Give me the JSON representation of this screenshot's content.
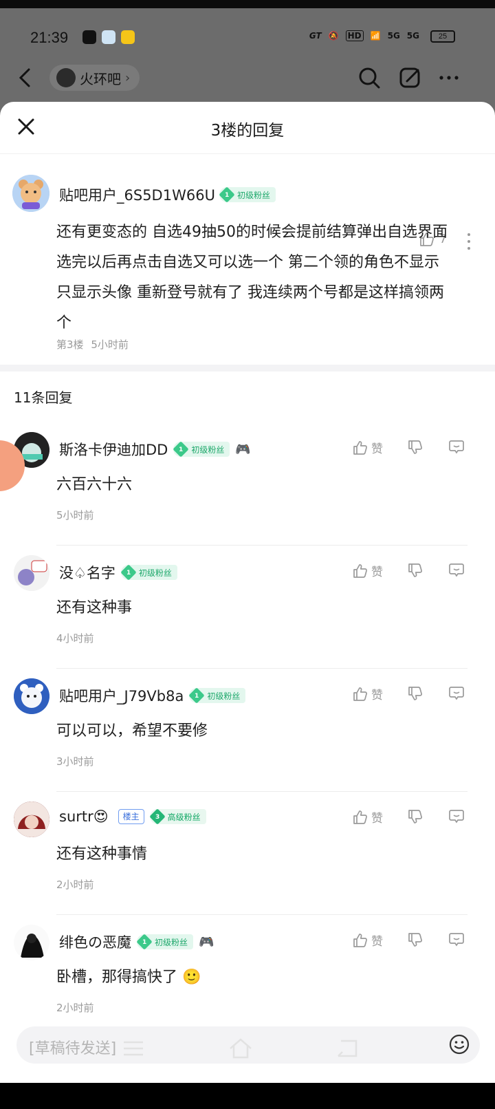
{
  "status": {
    "time": "21:39",
    "battery": "25",
    "signal1": "5G",
    "signal2": "5G",
    "hd": "HD",
    "gt": "GT"
  },
  "bg_nav": {
    "forum_name": "火环吧"
  },
  "sheet": {
    "title": "3楼的回复"
  },
  "main_post": {
    "username": "贴吧用户_6S5D1W66U",
    "badge_level": "1",
    "badge_label": "初级粉丝",
    "like_count": "7",
    "content_lines": [
      "还有更变态的 自选49抽50的时候会提前结算弹出自选界面",
      "选完以后再点击自选又可以选一个 第二个领的角色不显示",
      "只显示头像 重新登号就有了 我连续两个号都是这样搞领两",
      "个"
    ],
    "floor": "第3楼",
    "time": "5小时前"
  },
  "reply_count": "11条回复",
  "replies": [
    {
      "username": "斯洛卡伊迪加DD",
      "badge_level": "1",
      "badge_label": "初级粉丝",
      "text": "六百六十六",
      "time": "5小时前",
      "like_label": "赞"
    },
    {
      "username": "没♤名字",
      "badge_level": "1",
      "badge_label": "初级粉丝",
      "text": "还有这种事",
      "time": "4小时前",
      "like_label": "赞"
    },
    {
      "username": "贴吧用户_J79Vb8a",
      "badge_level": "1",
      "badge_label": "初级粉丝",
      "text": "可以可以，希望不要修",
      "time": "3小时前",
      "like_label": "赞"
    },
    {
      "username": "surtr😍",
      "owner_label": "楼主",
      "badge_level": "3",
      "badge_label": "高级粉丝",
      "text": "还有这种事情",
      "time": "2小时前",
      "like_label": "赞"
    },
    {
      "username": "绯色の恶魔",
      "badge_level": "1",
      "badge_label": "初级粉丝",
      "text": "卧槽，那得搞快了 🙂",
      "time": "2小时前",
      "like_label": "赞"
    }
  ],
  "composer": {
    "placeholder": "[草稿待发送]"
  },
  "colors": {
    "badge_green": "#3cc98a",
    "owner_blue": "#3a6fdc",
    "dim_bg": "#6c6c6c"
  }
}
